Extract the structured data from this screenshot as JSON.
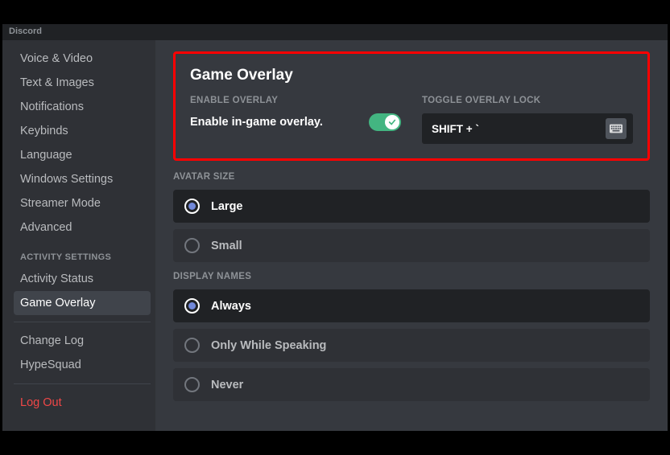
{
  "titlebar": "Discord",
  "sidebar": {
    "items_top": [
      {
        "label": "Voice & Video"
      },
      {
        "label": "Text & Images"
      },
      {
        "label": "Notifications"
      },
      {
        "label": "Keybinds"
      },
      {
        "label": "Language"
      },
      {
        "label": "Windows Settings"
      },
      {
        "label": "Streamer Mode"
      },
      {
        "label": "Advanced"
      }
    ],
    "header_activity": "ACTIVITY SETTINGS",
    "items_activity": [
      {
        "label": "Activity Status"
      },
      {
        "label": "Game Overlay",
        "active": true
      }
    ],
    "items_bottom": [
      {
        "label": "Change Log"
      },
      {
        "label": "HypeSquad"
      }
    ],
    "logout": "Log Out"
  },
  "main": {
    "title": "Game Overlay",
    "enable_header": "ENABLE OVERLAY",
    "enable_label": "Enable in-game overlay.",
    "enable_toggle_on": true,
    "lock_header": "TOGGLE OVERLAY LOCK",
    "lock_keybind": "SHIFT + `",
    "avatar_size": {
      "header": "AVATAR SIZE",
      "options": [
        {
          "label": "Large",
          "selected": true
        },
        {
          "label": "Small",
          "selected": false
        }
      ]
    },
    "display_names": {
      "header": "DISPLAY NAMES",
      "options": [
        {
          "label": "Always",
          "selected": true
        },
        {
          "label": "Only While Speaking",
          "selected": false
        },
        {
          "label": "Never",
          "selected": false
        }
      ]
    }
  }
}
